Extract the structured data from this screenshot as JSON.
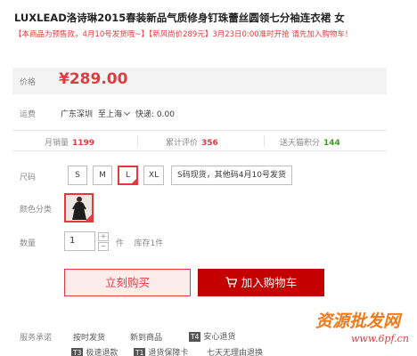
{
  "product": {
    "title": "LUXLEAD洛诗琳2015春装新品气质修身钉珠蕾丝圆领七分袖连衣裙 女",
    "notice_red": "【本商品为预售款，4月10号发货哦~】【新风尚价289元】3月23日0:00准时开抢 请先加入购物车！"
  },
  "price": {
    "label": "价格",
    "value": "¥289.00"
  },
  "shipping": {
    "label": "运费",
    "from": "广东深圳",
    "to": "至上海",
    "fee": "快递: 0.00"
  },
  "stats": [
    {
      "label": "月销量",
      "value": "1199"
    },
    {
      "label": "累计评价",
      "value": "356"
    },
    {
      "label": "送天猫积分",
      "value": "144"
    }
  ],
  "size": {
    "label": "尺码",
    "options": [
      "S",
      "M",
      "L",
      "XL",
      "S码现货，其他码4月10号发货"
    ],
    "selected": "L"
  },
  "color": {
    "label": "颜色分类"
  },
  "quantity": {
    "label": "数量",
    "value": "1",
    "unit": "件",
    "stock": "库存1件",
    "plus": "+",
    "minus": "−"
  },
  "actions": {
    "buy_now": "立刻购买",
    "add_to_cart": "加入购物车"
  },
  "promises": {
    "label": "服务承诺",
    "items": [
      "按时发货",
      "新到商品",
      "安心退货",
      "极速退款",
      "退货保障卡",
      "七天无理由退换"
    ],
    "badges": [
      "T4",
      "T3",
      "T1"
    ]
  },
  "watermark": {
    "main": "资源批发网",
    "url": "www.6pf.cn"
  },
  "colors": {
    "accent": "#e4393c",
    "cart": "#c40000",
    "green": "#3b9a26",
    "band": "#f3f3f3"
  }
}
